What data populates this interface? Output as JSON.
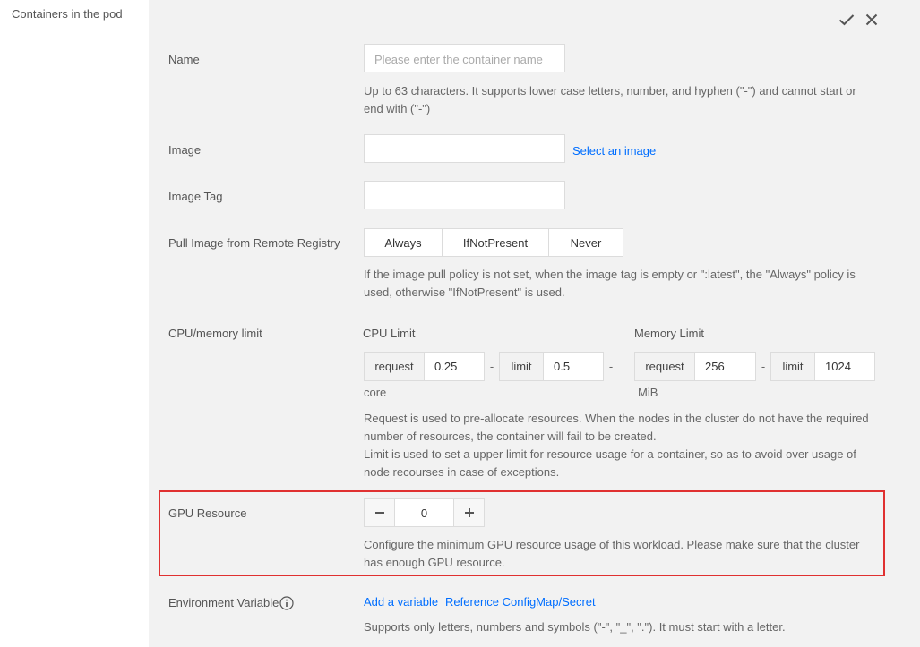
{
  "left": {
    "title": "Containers in the pod"
  },
  "actions": {
    "confirm_icon": "check-icon",
    "close_icon": "close-icon"
  },
  "name": {
    "label": "Name",
    "placeholder": "Please enter the container name",
    "hint_line1": "Up to 63 characters. It supports lower case letters, number, and hyphen (\"-\") and cannot start or",
    "hint_line2": "end with (\"-\")"
  },
  "image": {
    "label": "Image",
    "value": "",
    "select_link": "Select an image"
  },
  "image_tag": {
    "label": "Image Tag",
    "value": ""
  },
  "pull": {
    "label": "Pull Image from Remote Registry",
    "options": [
      "Always",
      "IfNotPresent",
      "Never"
    ],
    "hint_line1": "If the image pull policy is not set, when the image tag is empty or \":latest\", the \"Always\" policy is",
    "hint_line2": "used, otherwise \"IfNotPresent\" is used."
  },
  "resources": {
    "label": "CPU/memory limit",
    "cpu": {
      "title": "CPU Limit",
      "request_label": "request",
      "request": "0.25",
      "limit_label": "limit",
      "limit": "0.5",
      "unit": "core"
    },
    "memory": {
      "title": "Memory Limit",
      "request_label": "request",
      "request": "256",
      "limit_label": "limit",
      "limit": "1024",
      "unit": "MiB"
    },
    "separator": "-",
    "hint_line1": "Request is used to pre-allocate resources. When the nodes in the cluster do not have the required",
    "hint_line2": "number of resources, the container will fail to be created.",
    "hint_line3": "Limit is used to set a upper limit for resource usage for a container, so as to avoid over usage of",
    "hint_line4": "node recourses in case of exceptions."
  },
  "gpu": {
    "label": "GPU Resource",
    "value": "0",
    "decrement": "−",
    "increment": "+",
    "hint_line1": "Configure the minimum GPU resource usage of this workload. Please make sure that the cluster",
    "hint_line2": "has enough GPU resource.",
    "highlight_color": "#e03131"
  },
  "env": {
    "label": "Environment Variable",
    "add_link": "Add a variable",
    "ref_link": "Reference ConfigMap/Secret",
    "hint": "Supports only letters, numbers and symbols (\"-\", \"_\", \".\"). It must start with a letter."
  },
  "colors": {
    "link": "#006eff",
    "panel_bg": "#f2f2f2"
  }
}
